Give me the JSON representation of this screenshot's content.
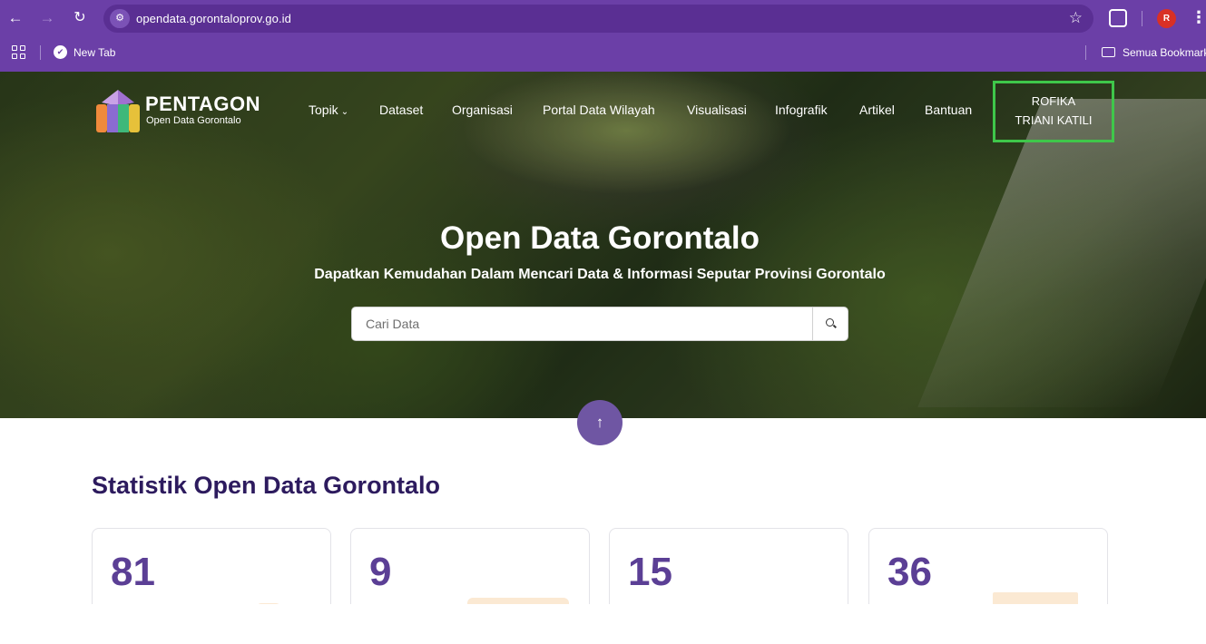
{
  "browser": {
    "url": "opendata.gorontaloprov.go.id",
    "bookmarks": [
      {
        "label": "New Tab"
      }
    ],
    "all_bookmarks_label": "Semua Bookmark",
    "avatar_initial": "R",
    "nav_icons": {
      "back": "←",
      "forward": "→",
      "reload": "C",
      "star": "☆",
      "menu": "⋮"
    }
  },
  "site": {
    "brand": {
      "name": "PENTAGON",
      "tagline": "Open Data Gorontalo"
    },
    "nav": [
      {
        "label": "Topik",
        "has_dropdown": true
      },
      {
        "label": "Dataset"
      },
      {
        "label": "Organisasi"
      },
      {
        "label": "Portal Data Wilayah"
      },
      {
        "label": "Visualisasi"
      },
      {
        "label": "Infografik"
      },
      {
        "label": "Artikel"
      },
      {
        "label": "Bantuan"
      }
    ],
    "user": {
      "line1": "ROFIKA",
      "line2": "TRIANI KATILI"
    },
    "hero": {
      "title": "Open Data Gorontalo",
      "subtitle": "Dapatkan Kemudahan Dalam Mencari Data & Informasi Seputar Provinsi Gorontalo",
      "search_placeholder": "Cari Data"
    },
    "scroll_up_icon": "↑",
    "stats": {
      "title": "Statistik Open Data Gorontalo",
      "cards": [
        {
          "value": "81"
        },
        {
          "value": "9"
        },
        {
          "value": "15"
        },
        {
          "value": "36"
        }
      ]
    },
    "colors": {
      "chrome": "#6b3fa7",
      "accent": "#6f56a3",
      "heading": "#2d1b5e",
      "number": "#5b3f95",
      "highlight": "#3fc74a"
    }
  }
}
